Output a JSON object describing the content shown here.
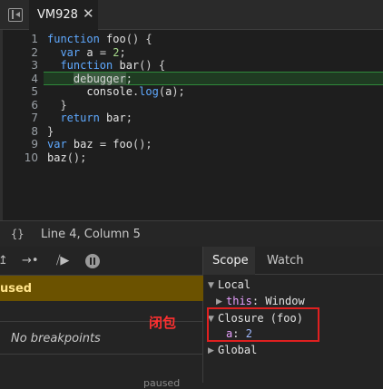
{
  "tab": {
    "name": "VM928",
    "close": "✕"
  },
  "editor": {
    "line_numbers": [
      "1",
      "2",
      "3",
      "4",
      "5",
      "6",
      "7",
      "8",
      "9",
      "10"
    ],
    "current_line": 4
  },
  "status": {
    "position": "Line 4, Column 5",
    "braces": "{}"
  },
  "debugger": {
    "paused_label": "used",
    "no_breakpoints": "No breakpoints",
    "paused_small": "paused"
  },
  "scope": {
    "tabs": [
      "Scope",
      "Watch"
    ],
    "local": {
      "label": "Local",
      "this_key": "this",
      "this_value": "Window"
    },
    "closure": {
      "label": "Closure (foo)",
      "var_key": "a",
      "var_value": "2"
    },
    "global": {
      "label": "Global"
    }
  },
  "annotation": {
    "label": "闭包",
    "color": "#e02020"
  },
  "colors": {
    "paused_bar": "#6b5200",
    "highlight_line": "#1f3b22",
    "keyword": "#5fa9ff"
  }
}
